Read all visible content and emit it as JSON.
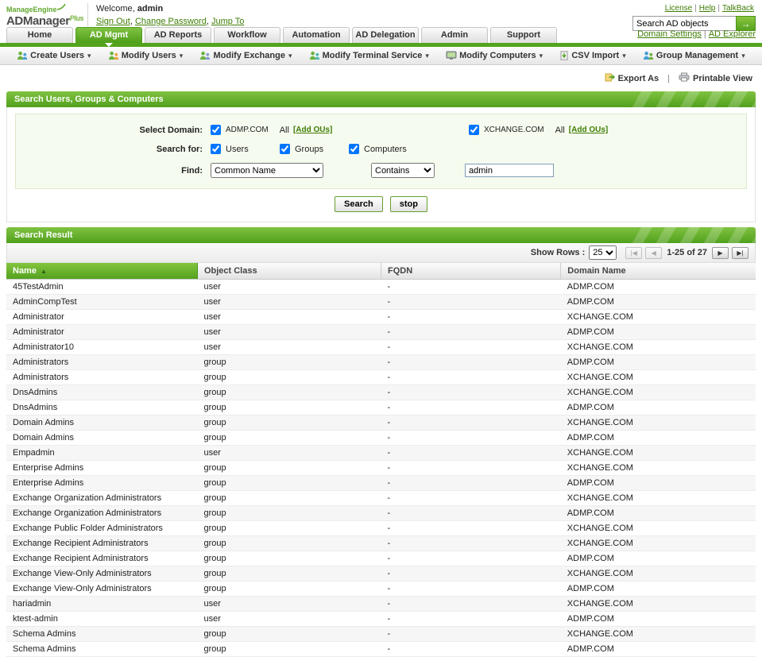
{
  "header": {
    "brand": {
      "company": "ManageEngine",
      "product": "ADManager",
      "suffix": "Plus"
    },
    "welcome_label": "Welcome,",
    "username": "admin",
    "account_links": [
      "Sign Out",
      "Change Password",
      "Jump To"
    ],
    "top_links": [
      "License",
      "Help",
      "TalkBack"
    ],
    "search_value": "Search AD objects"
  },
  "tabs": {
    "items": [
      "Home",
      "AD Mgmt",
      "AD Reports",
      "Workflow",
      "Automation",
      "AD Delegation",
      "Admin",
      "Support"
    ],
    "active": "AD Mgmt",
    "right_links": [
      "Domain Settings",
      "AD Explorer"
    ]
  },
  "toolbar": {
    "items": [
      {
        "label": "Create Users",
        "icon": "create-users-icon"
      },
      {
        "label": "Modify Users",
        "icon": "modify-users-icon"
      },
      {
        "label": "Modify Exchange",
        "icon": "modify-exchange-icon"
      },
      {
        "label": "Modify Terminal Service",
        "icon": "modify-terminal-service-icon"
      },
      {
        "label": "Modify Computers",
        "icon": "modify-computers-icon"
      },
      {
        "label": "CSV Import",
        "icon": "csv-import-icon"
      },
      {
        "label": "Group Management",
        "icon": "group-management-icon"
      }
    ]
  },
  "actions": {
    "export_label": "Export As",
    "print_label": "Printable View"
  },
  "search_panel": {
    "title": "Search Users, Groups & Computers",
    "select_domain_label": "Select Domain:",
    "domains": [
      {
        "name": "ADMP.COM",
        "checked": true,
        "all_label": "All",
        "add_ous_label": "[Add OUs]"
      },
      {
        "name": "XCHANGE.COM",
        "checked": true,
        "all_label": "All",
        "add_ous_label": "[Add OUs]"
      }
    ],
    "search_for_label": "Search for:",
    "object_types": [
      {
        "label": "Users",
        "checked": true
      },
      {
        "label": "Groups",
        "checked": true
      },
      {
        "label": "Computers",
        "checked": true
      }
    ],
    "find_label": "Find:",
    "attribute_value": "Common Name",
    "operator_value": "Contains",
    "query_value": "admin",
    "search_button": "Search",
    "stop_button": "stop"
  },
  "results": {
    "title": "Search Result",
    "show_rows_label": "Show Rows :",
    "show_rows_value": "25",
    "page_info": "1-25 of 27",
    "sort_indicator": "▲",
    "pager": [
      {
        "name": "first-page",
        "glyph": "|◀",
        "enabled": false
      },
      {
        "name": "prev-page",
        "glyph": "◀",
        "enabled": false
      },
      {
        "name": "next-page",
        "glyph": "▶",
        "enabled": true
      },
      {
        "name": "last-page",
        "glyph": "▶|",
        "enabled": true
      }
    ],
    "columns": [
      "Name",
      "Object Class",
      "FQDN",
      "Domain Name"
    ],
    "rows": [
      [
        "45TestAdmin",
        "user",
        "-",
        "ADMP.COM"
      ],
      [
        "AdminCompTest",
        "user",
        "-",
        "ADMP.COM"
      ],
      [
        "Administrator",
        "user",
        "-",
        "XCHANGE.COM"
      ],
      [
        "Administrator",
        "user",
        "-",
        "ADMP.COM"
      ],
      [
        "Administrator10",
        "user",
        "-",
        "XCHANGE.COM"
      ],
      [
        "Administrators",
        "group",
        "-",
        "ADMP.COM"
      ],
      [
        "Administrators",
        "group",
        "-",
        "XCHANGE.COM"
      ],
      [
        "DnsAdmins",
        "group",
        "-",
        "XCHANGE.COM"
      ],
      [
        "DnsAdmins",
        "group",
        "-",
        "ADMP.COM"
      ],
      [
        "Domain Admins",
        "group",
        "-",
        "XCHANGE.COM"
      ],
      [
        "Domain Admins",
        "group",
        "-",
        "ADMP.COM"
      ],
      [
        "Empadmin",
        "user",
        "-",
        "XCHANGE.COM"
      ],
      [
        "Enterprise Admins",
        "group",
        "-",
        "XCHANGE.COM"
      ],
      [
        "Enterprise Admins",
        "group",
        "-",
        "ADMP.COM"
      ],
      [
        "Exchange Organization Administrators",
        "group",
        "-",
        "XCHANGE.COM"
      ],
      [
        "Exchange Organization Administrators",
        "group",
        "-",
        "ADMP.COM"
      ],
      [
        "Exchange Public Folder Administrators",
        "group",
        "-",
        "XCHANGE.COM"
      ],
      [
        "Exchange Recipient Administrators",
        "group",
        "-",
        "XCHANGE.COM"
      ],
      [
        "Exchange Recipient Administrators",
        "group",
        "-",
        "ADMP.COM"
      ],
      [
        "Exchange View-Only Administrators",
        "group",
        "-",
        "XCHANGE.COM"
      ],
      [
        "Exchange View-Only Administrators",
        "group",
        "-",
        "ADMP.COM"
      ],
      [
        "hariadmin",
        "user",
        "-",
        "XCHANGE.COM"
      ],
      [
        "ktest-admin",
        "user",
        "-",
        "ADMP.COM"
      ],
      [
        "Schema Admins",
        "group",
        "-",
        "XCHANGE.COM"
      ],
      [
        "Schema Admins",
        "group",
        "-",
        "ADMP.COM"
      ]
    ]
  },
  "colors": {
    "accent_green": "#55a31d",
    "accent_green_light": "#83c43e",
    "link_green": "#3e7d04",
    "tab_active_top": "#7fc241",
    "row_alt": "#f6f6f6"
  }
}
